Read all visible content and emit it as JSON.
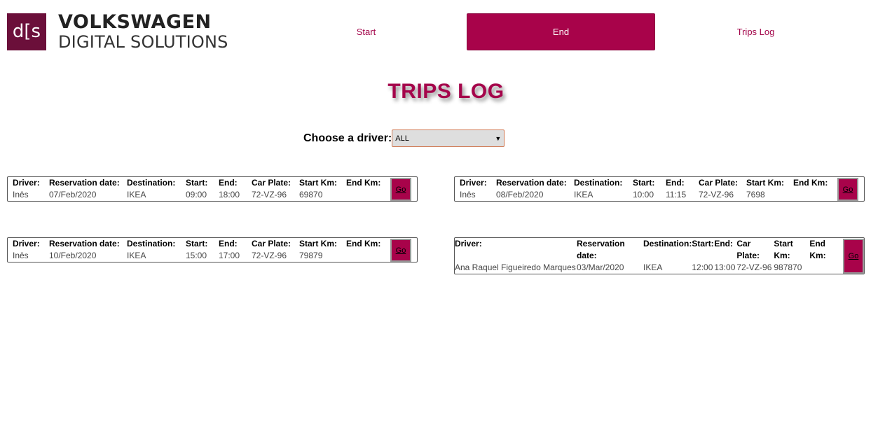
{
  "header": {
    "logo_mark": "d[s",
    "logo_line1": "VOLKSWAGEN",
    "logo_line2": "DIGITAL SOLUTIONS"
  },
  "nav": {
    "start_label": "Start",
    "end_label": "End",
    "tripslog_label": "Trips Log",
    "active": "End"
  },
  "page_title": "TRIPS LOG",
  "driver_filter": {
    "label": "Choose a driver:",
    "selected": "ALL"
  },
  "columns": {
    "driver": "Driver:",
    "reservation_date": "Reservation date:",
    "destination": "Destination:",
    "start": "Start:",
    "end": "End:",
    "car_plate": "Car Plate:",
    "start_km": "Start Km:",
    "end_km": "End Km:"
  },
  "go_label": "Go",
  "trips": [
    {
      "driver": "Inês",
      "reservation_date": "07/Feb/2020",
      "destination": "IKEA",
      "start": "09:00",
      "end": "18:00",
      "car_plate": "72-VZ-96",
      "start_km": "69870",
      "end_km": ""
    },
    {
      "driver": "Inês",
      "reservation_date": "08/Feb/2020",
      "destination": "IKEA",
      "start": "10:00",
      "end": "11:15",
      "car_plate": "72-VZ-96",
      "start_km": "7698",
      "end_km": ""
    },
    {
      "driver": "Inês",
      "reservation_date": "10/Feb/2020",
      "destination": "IKEA",
      "start": "15:00",
      "end": "17:00",
      "car_plate": "72-VZ-96",
      "start_km": "79879",
      "end_km": ""
    },
    {
      "driver": "Ana Raquel Figueiredo Marques",
      "reservation_date": "03/Mar/2020",
      "destination": "IKEA",
      "start": "12:00",
      "end": "13:00",
      "car_plate": "72-VZ-96",
      "start_km": "987870",
      "end_km": ""
    }
  ],
  "colors": {
    "accent": "#a8034a",
    "logo_bg": "#6b0f3a"
  }
}
